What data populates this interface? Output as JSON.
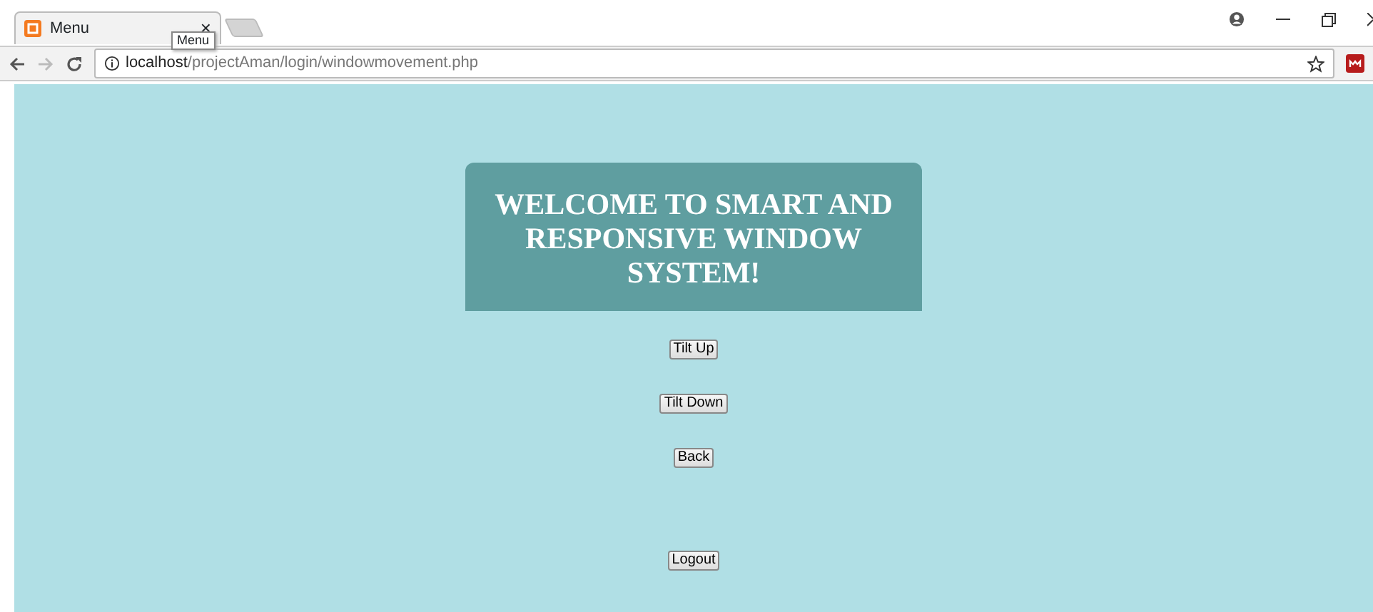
{
  "browser": {
    "tab": {
      "title": "Menu",
      "close": "×",
      "tooltip": "Menu"
    },
    "address": {
      "host": "localhost",
      "path": "/projectAman/login/windowmovement.php"
    }
  },
  "page": {
    "heading": "WELCOME TO SMART AND RESPONSIVE WINDOW SYSTEM!",
    "buttons": [
      {
        "label": "Tilt Up"
      },
      {
        "label": "Tilt Down"
      },
      {
        "label": "Back"
      },
      {
        "label": "Logout"
      }
    ]
  }
}
